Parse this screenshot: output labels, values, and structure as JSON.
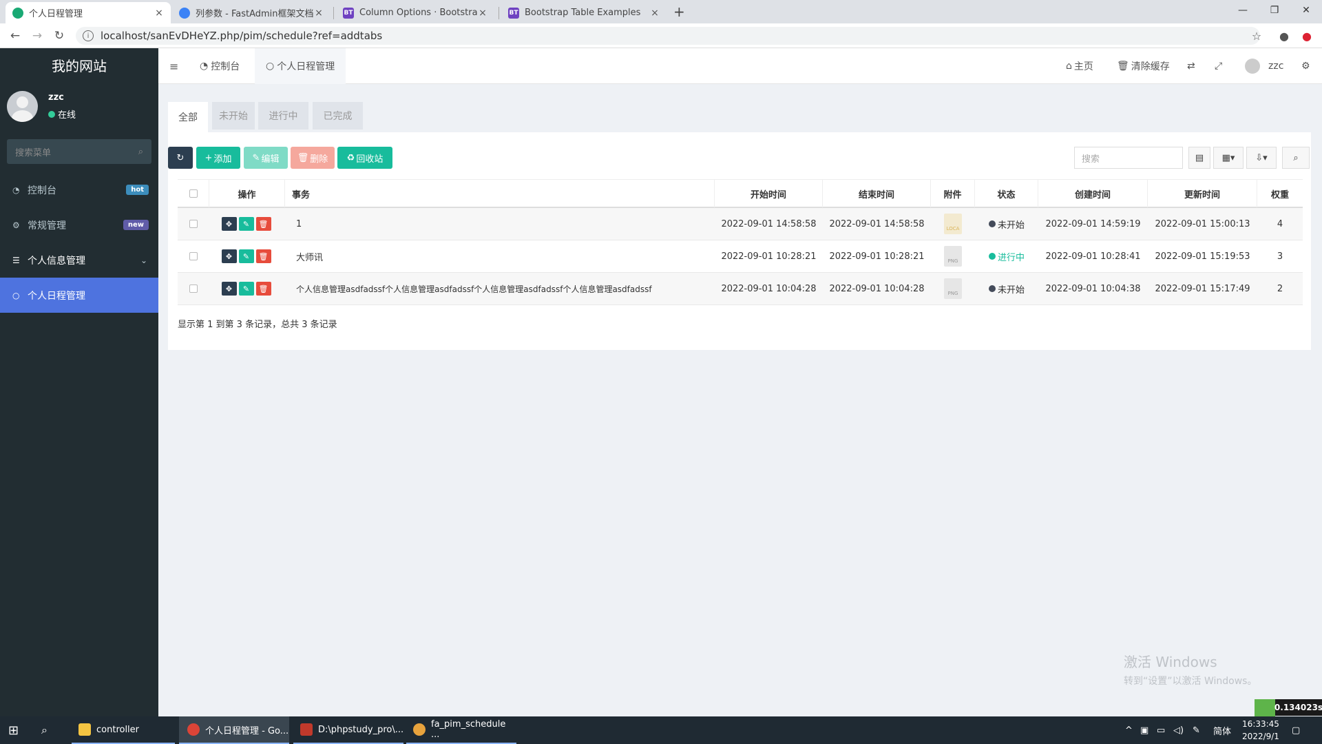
{
  "browser": {
    "tabs": [
      {
        "label": "个人日程管理",
        "icon_color": "#19a974",
        "active": true
      },
      {
        "label": "列参数 - FastAdmin框架文档",
        "icon_color": "#3b82f6",
        "active": false
      },
      {
        "label": "Column Options · Bootstrap T",
        "icon_color": "#6f42c1",
        "icon_text": "BT",
        "active": false
      },
      {
        "label": "Bootstrap Table Examples",
        "icon_color": "#6f42c1",
        "icon_text": "BT",
        "active": false
      }
    ],
    "close_glyph": "×",
    "new_tab_glyph": "+",
    "url": "localhost/sanEvDHeYZ.php/pim/schedule?ref=addtabs"
  },
  "sidebar": {
    "site_name": "我的网站",
    "user": {
      "name": "zzc",
      "status": "在线"
    },
    "search_placeholder": "搜索菜单",
    "items": [
      {
        "label": "控制台",
        "icon": "dashboard-icon",
        "badge": "hot",
        "badge_color": "#3c8dbc"
      },
      {
        "label": "常规管理",
        "icon": "cogs-icon",
        "badge": "new",
        "badge_color": "#605ca8"
      },
      {
        "label": "个人信息管理",
        "icon": "list-icon"
      },
      {
        "label": "个人日程管理",
        "icon": "circle-icon",
        "active": true
      }
    ]
  },
  "header": {
    "tab_dashboard": "控制台",
    "tab_schedule": "个人日程管理",
    "home": "主页",
    "clear_cache": "清除缓存",
    "username": "zzc"
  },
  "panel": {
    "tabs": [
      "全部",
      "未开始",
      "进行中",
      "已完成"
    ],
    "buttons": {
      "add": "添加",
      "edit": "编辑",
      "delete": "删除",
      "recycle": "回收站"
    },
    "search_placeholder": "搜索",
    "columns": [
      "操作",
      "事务",
      "开始时间",
      "结束时间",
      "附件",
      "状态",
      "创建时间",
      "更新时间",
      "权重"
    ],
    "rows": [
      {
        "title": "1",
        "start": "2022-09-01 14:58:58",
        "end": "2022-09-01 14:58:58",
        "file": "LOCA",
        "status": "未开始",
        "status_color": "#444b5a",
        "created": "2022-09-01 14:59:19",
        "updated": "2022-09-01 15:00:13",
        "weight": "4"
      },
      {
        "title": "大师讯",
        "start": "2022-09-01 10:28:21",
        "end": "2022-09-01 10:28:21",
        "file": "PNG",
        "status": "进行中",
        "status_color": "#18bc9c",
        "created": "2022-09-01 10:28:41",
        "updated": "2022-09-01 15:19:53",
        "weight": "3"
      },
      {
        "title": "个人信息管理asdfadssf个人信息管理asdfadssf个人信息管理asdfadssf个人信息管理asdfadssf",
        "start": "2022-09-01 10:04:28",
        "end": "2022-09-01 10:04:28",
        "file": "PNG",
        "status": "未开始",
        "status_color": "#444b5a",
        "created": "2022-09-01 10:04:38",
        "updated": "2022-09-01 15:17:49",
        "weight": "2"
      }
    ],
    "footer": "显示第 1 到第 3 条记录，总共 3 条记录"
  },
  "watermark": {
    "line1": "激活 Windows",
    "line2": "转到“设置”以激活 Windows。"
  },
  "timer": "0.134023s",
  "taskbar": {
    "items": [
      "controller",
      "个人日程管理 - Go...",
      "D:\\phpstudy_pro\\...",
      "fa_pim_schedule ..."
    ],
    "ime": "简体",
    "time": "16:33:45",
    "date": "2022/9/1"
  }
}
